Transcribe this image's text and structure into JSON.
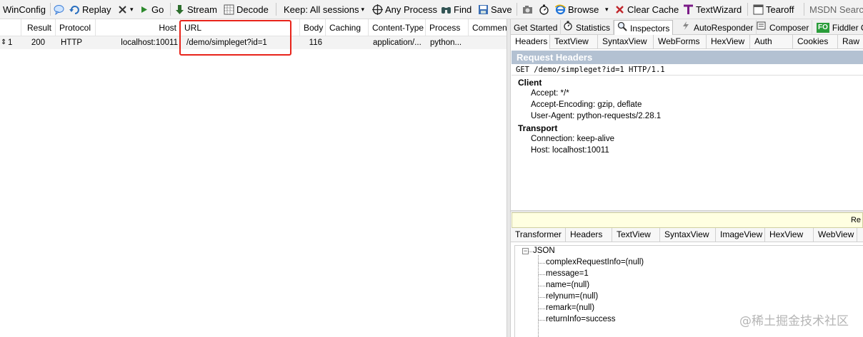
{
  "toolbar": {
    "winconfig": "WinConfig",
    "replay": "Replay",
    "remove_chevron": "▾",
    "go": "Go",
    "stream": "Stream",
    "decode": "Decode",
    "keep": "Keep: All sessions",
    "any_process": "Any Process",
    "find": "Find",
    "save": "Save",
    "browse": "Browse",
    "clear_cache": "Clear Cache",
    "textwizard": "TextWizard",
    "tearoff": "Tearoff",
    "msdn_search": "MSDN Searc"
  },
  "grid": {
    "columns": [
      "Result",
      "Protocol",
      "Host",
      "URL",
      "Body",
      "Caching",
      "Content-Type",
      "Process",
      "Comment"
    ],
    "row": {
      "num": "1",
      "result": "200",
      "protocol": "HTTP",
      "host": "localhost:10011",
      "url": "/demo/simpleget?id=1",
      "body": "116",
      "caching": "",
      "content_type": "application/...",
      "process": "python...",
      "comment": ""
    }
  },
  "inspector": {
    "top_tabs": [
      "Get Started",
      "Statistics",
      "Inspectors",
      "AutoResponder",
      "Composer",
      "Fiddler Or"
    ],
    "fo_badge": "FO",
    "request_tabs": [
      "Headers",
      "TextView",
      "SyntaxView",
      "WebForms",
      "HexView",
      "Auth",
      "Cookies",
      "Raw"
    ],
    "request_headers_title": "Request Headers",
    "request_line": "GET /demo/simpleget?id=1 HTTP/1.1",
    "client_label": "Client",
    "client_headers": [
      "Accept: */*",
      "Accept-Encoding: gzip, deflate",
      "User-Agent: python-requests/2.28.1"
    ],
    "transport_label": "Transport",
    "transport_headers": [
      "Connection: keep-alive",
      "Host: localhost:10011"
    ],
    "response_bar_text": "Re",
    "response_tabs": [
      "Transformer",
      "Headers",
      "TextView",
      "SyntaxView",
      "ImageView",
      "HexView",
      "WebView"
    ],
    "json_root": "JSON",
    "json_expander": "−",
    "json_items": [
      "complexRequestInfo=(null)",
      "message=1",
      "name=(null)",
      "relynum=(null)",
      "remark=(null)",
      "returnInfo=success"
    ]
  },
  "watermark": "@稀土掘金技术社区"
}
